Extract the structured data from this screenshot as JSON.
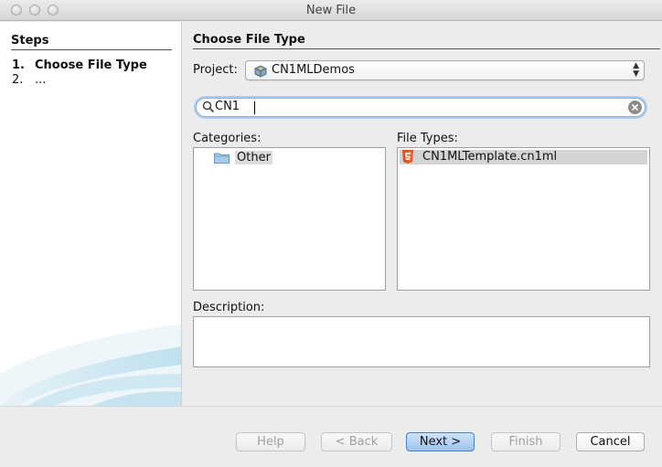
{
  "window": {
    "title": "New File"
  },
  "steps": {
    "header": "Steps",
    "items": [
      {
        "num": "1.",
        "label": "Choose File Type"
      },
      {
        "num": "2.",
        "label": "..."
      }
    ]
  },
  "main": {
    "section_title": "Choose File Type",
    "project": {
      "label": "Project:",
      "value": "CN1MLDemos"
    },
    "search": {
      "value": "CN1"
    },
    "categories": {
      "label": "Categories:",
      "items": [
        "Other"
      ]
    },
    "file_types": {
      "label": "File Types:",
      "items": [
        "CN1MLTemplate.cn1ml"
      ]
    },
    "description": {
      "label": "Description:",
      "value": ""
    }
  },
  "buttons": {
    "help": "Help",
    "back": "< Back",
    "next": "Next >",
    "finish": "Finish",
    "cancel": "Cancel"
  },
  "icons": {
    "project": "project-icon",
    "search": "search-icon",
    "clear": "clear-icon",
    "folder": "folder-icon",
    "file": "html5-icon"
  },
  "colors": {
    "accent": "#aecbee",
    "primary_button": "#9fc2ef",
    "html5": "#e34f26"
  }
}
